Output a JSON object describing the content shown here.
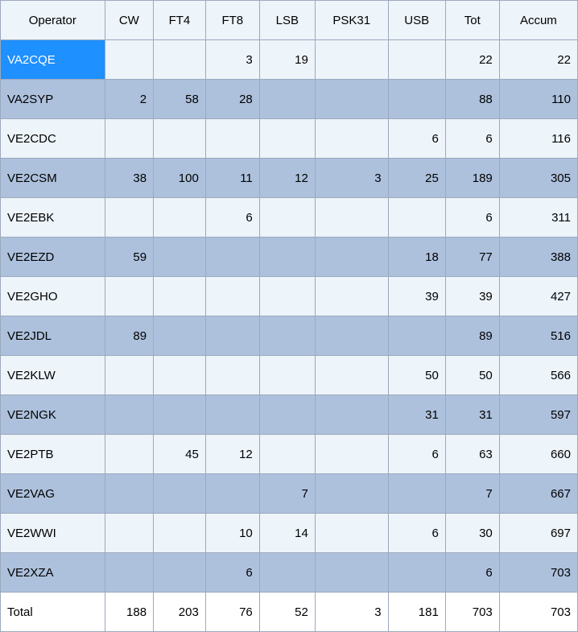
{
  "table": {
    "headers": [
      "Operator",
      "CW",
      "FT4",
      "FT8",
      "LSB",
      "PSK31",
      "USB",
      "Tot",
      "Accum"
    ],
    "rows": [
      {
        "operator": "VA2CQE",
        "values": [
          "",
          "",
          "3",
          "19",
          "",
          "",
          "22",
          "22"
        ],
        "selected": true
      },
      {
        "operator": "VA2SYP",
        "values": [
          "2",
          "58",
          "28",
          "",
          "",
          "",
          "88",
          "110"
        ]
      },
      {
        "operator": "VE2CDC",
        "values": [
          "",
          "",
          "",
          "",
          "",
          "6",
          "6",
          "116"
        ]
      },
      {
        "operator": "VE2CSM",
        "values": [
          "38",
          "100",
          "11",
          "12",
          "3",
          "25",
          "189",
          "305"
        ]
      },
      {
        "operator": "VE2EBK",
        "values": [
          "",
          "",
          "6",
          "",
          "",
          "",
          "6",
          "311"
        ]
      },
      {
        "operator": "VE2EZD",
        "values": [
          "59",
          "",
          "",
          "",
          "",
          "18",
          "77",
          "388"
        ]
      },
      {
        "operator": "VE2GHO",
        "values": [
          "",
          "",
          "",
          "",
          "",
          "39",
          "39",
          "427"
        ]
      },
      {
        "operator": "VE2JDL",
        "values": [
          "89",
          "",
          "",
          "",
          "",
          "",
          "89",
          "516"
        ]
      },
      {
        "operator": "VE2KLW",
        "values": [
          "",
          "",
          "",
          "",
          "",
          "50",
          "50",
          "566"
        ]
      },
      {
        "operator": "VE2NGK",
        "values": [
          "",
          "",
          "",
          "",
          "",
          "31",
          "31",
          "597"
        ]
      },
      {
        "operator": "VE2PTB",
        "values": [
          "",
          "45",
          "12",
          "",
          "",
          "6",
          "63",
          "660"
        ]
      },
      {
        "operator": "VE2VAG",
        "values": [
          "",
          "",
          "",
          "7",
          "",
          "",
          "7",
          "667"
        ]
      },
      {
        "operator": "VE2WWI",
        "values": [
          "",
          "",
          "10",
          "14",
          "",
          "6",
          "30",
          "697"
        ]
      },
      {
        "operator": "VE2XZA",
        "values": [
          "",
          "",
          "6",
          "",
          "",
          "",
          "6",
          "703"
        ]
      }
    ],
    "total": {
      "label": "Total",
      "values": [
        "188",
        "203",
        "76",
        "52",
        "3",
        "181",
        "703",
        "703"
      ]
    }
  }
}
